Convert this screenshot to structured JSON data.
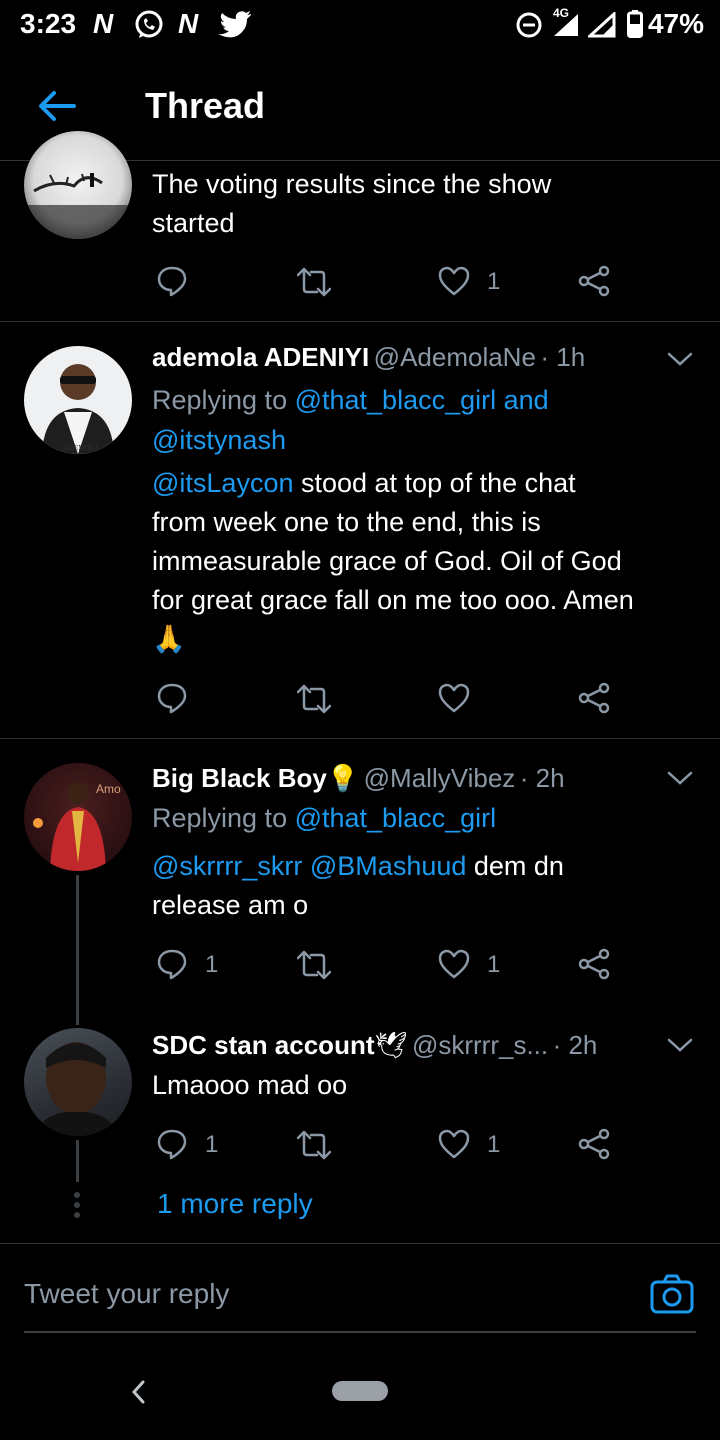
{
  "status_bar": {
    "time": "3:23",
    "app_icons": [
      "N",
      "whatsapp-icon",
      "N",
      "twitter-icon"
    ],
    "network": "4G",
    "battery": "47%"
  },
  "header": {
    "title": "Thread"
  },
  "tweets": [
    {
      "text_lines": [
        "The voting results since the show",
        "started"
      ],
      "reply_count": "",
      "retweet_count": "",
      "like_count": "1"
    },
    {
      "name": "ademola ADENIYI",
      "handle": "@AdemolaNe",
      "time": "· 1h",
      "replying_prefix": "Replying to ",
      "replying_to": "@that_blacc_girl and",
      "replying_to_2": "@itstynash",
      "mention": "@itsLaycon",
      "text_1": " stood at top of the chat",
      "text_lines": [
        "from week one to the end, this is",
        "immeasurable grace of God. Oil of God",
        "for great grace fall on me too ooo. Amen"
      ],
      "emoji": "🙏",
      "like_count": ""
    },
    {
      "name": "Big Black Boy",
      "name_emoji": "💡",
      "handle": "@MallyVibez",
      "time": "· 2h",
      "replying_prefix": "Replying to ",
      "replying_to": "@that_blacc_girl",
      "mention_1": "@skrrrr_skrr",
      "mention_2": "@BMashuud",
      "text_1": " dem dn",
      "text_2": "release am o",
      "reply_count": "1",
      "like_count": "1"
    },
    {
      "name": "SDC stan account",
      "name_emoji": "🕊",
      "handle": "@skrrrr_s...",
      "time": "· 2h",
      "text": "Lmaooo mad oo",
      "reply_count": "1",
      "like_count": "1"
    }
  ],
  "more_reply": "1 more reply",
  "reply_box": {
    "placeholder": "Tweet your reply"
  },
  "colors": {
    "accent": "#1d9bf0",
    "muted": "#8b98a5",
    "background": "#000000"
  }
}
